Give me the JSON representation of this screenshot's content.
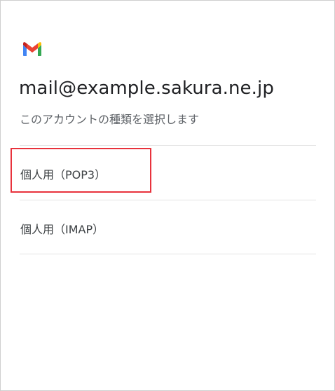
{
  "account": {
    "email": "mail@example.sakura.ne.jp",
    "prompt": "このアカウントの種類を選択します"
  },
  "options": [
    {
      "label": "個人用（POP3）",
      "highlighted": true
    },
    {
      "label": "個人用（IMAP）",
      "highlighted": false
    }
  ],
  "logo": {
    "icon": "gmail-icon"
  },
  "colors": {
    "highlight": "#e8323c",
    "gmail_blue": "#4285F4",
    "gmail_red": "#EA4335",
    "gmail_yellow": "#FBBC04",
    "gmail_green": "#34A853"
  }
}
